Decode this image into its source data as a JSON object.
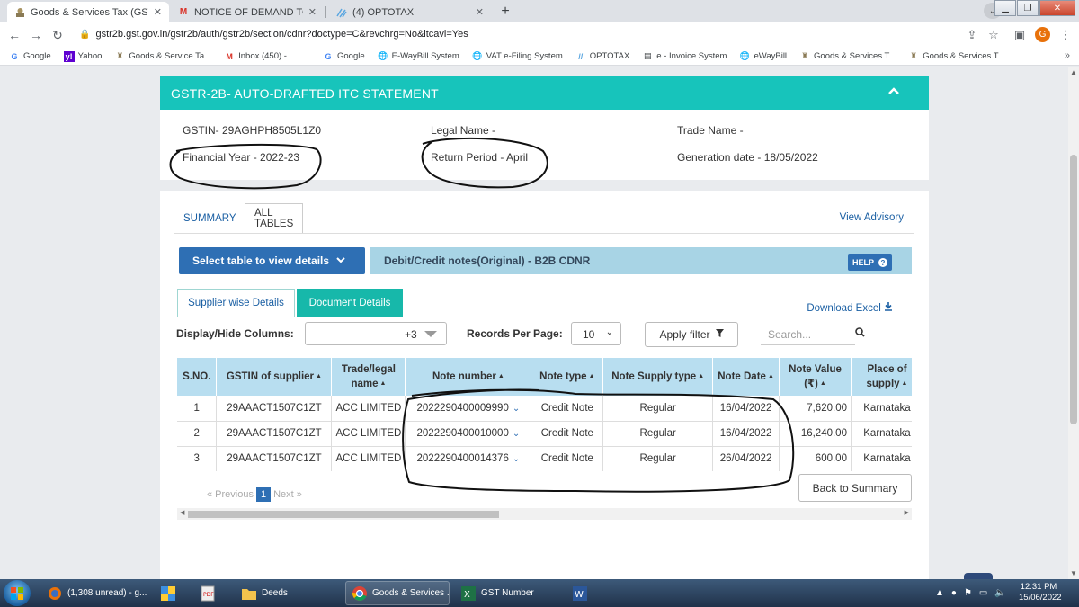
{
  "browser": {
    "tabs": [
      {
        "title": "Goods & Services Tax (GST) | GST",
        "active": true
      },
      {
        "title": "NOTICE OF DEMAND TO ENROLL",
        "active": false
      },
      {
        "title": "(4) OPTOTAX",
        "active": false
      }
    ],
    "url": "gstr2b.gst.gov.in/gstr2b/auth/gstr2b/section/cdnr?doctype=C&revchrg=No&itcavl=Yes",
    "profile_initial": "G",
    "bookmarks": [
      {
        "label": "Google",
        "icon": "google-g-icon"
      },
      {
        "label": "Yahoo",
        "icon": "yahoo-icon"
      },
      {
        "label": "Goods & Service Ta...",
        "icon": "emblem-icon"
      },
      {
        "label": "Inbox (450) -",
        "icon": "gmail-icon"
      },
      {
        "label": "Google",
        "icon": "google-g-icon"
      },
      {
        "label": "E-WayBill System",
        "icon": "globe-icon"
      },
      {
        "label": "VAT e-Filing System",
        "icon": "globe-icon"
      },
      {
        "label": "OPTOTAX",
        "icon": "optotax-icon"
      },
      {
        "label": "e - Invoice System",
        "icon": "document-icon"
      },
      {
        "label": "eWayBill",
        "icon": "globe-icon"
      },
      {
        "label": "Goods & Services T...",
        "icon": "emblem-icon"
      },
      {
        "label": "Goods & Services T...",
        "icon": "emblem-icon"
      }
    ]
  },
  "header": {
    "title": "GSTR-2B- AUTO-DRAFTED ITC STATEMENT"
  },
  "info": {
    "gstin": "GSTIN- 29AGHPH8505L1Z0",
    "legal_name": "Legal Name -",
    "trade_name": "Trade Name -",
    "financial_year": "Financial Year - 2022-23",
    "return_period": "Return Period - April",
    "generation_date": "Generation date - 18/05/2022"
  },
  "tabs": {
    "summary": "SUMMARY",
    "all_tables": "ALL TABLES",
    "view_advisory": "View Advisory"
  },
  "controls": {
    "select_table": "Select table to view details",
    "table_title": "Debit/Credit notes(Original) - B2B CDNR",
    "help": "HELP",
    "supplier_wise": "Supplier wise Details",
    "document_details": "Document Details",
    "download_excel": "Download Excel",
    "display_hide_label": "Display/Hide Columns:",
    "display_hide_value": "+3",
    "records_label": "Records Per Page:",
    "records_value": "10",
    "apply_filter": "Apply filter",
    "search_placeholder": "Search..."
  },
  "table": {
    "headers": [
      "S.NO.",
      "GSTIN of supplier",
      "Trade/legal name",
      "Note number",
      "Note type",
      "Note Supply type",
      "Note Date",
      "Note Value (₹)",
      "Place of supply"
    ],
    "rows": [
      [
        "1",
        "29AAACT1507C1ZT",
        "ACC LIMITED",
        "2022290400009990",
        "Credit Note",
        "Regular",
        "16/04/2022",
        "7,620.00",
        "Karnataka"
      ],
      [
        "2",
        "29AAACT1507C1ZT",
        "ACC LIMITED",
        "2022290400010000",
        "Credit Note",
        "Regular",
        "16/04/2022",
        "16,240.00",
        "Karnataka"
      ],
      [
        "3",
        "29AAACT1507C1ZT",
        "ACC LIMITED",
        "2022290400014376",
        "Credit Note",
        "Regular",
        "26/04/2022",
        "600.00",
        "Karnataka"
      ]
    ]
  },
  "pagination": {
    "previous": "« Previous",
    "current": "1",
    "next": "Next »"
  },
  "footer": {
    "back_to_summary": "Back to Summary"
  },
  "taskbar": {
    "items": [
      {
        "label": "(1,308 unread) - g...",
        "icon": "thunderbird-icon"
      },
      {
        "label": "",
        "icon": "windows-explorer-icon"
      },
      {
        "label": "",
        "icon": "pdf-icon"
      },
      {
        "label": "Deeds",
        "icon": "folder-icon"
      },
      {
        "label": "Goods & Services ...",
        "icon": "chrome-icon"
      },
      {
        "label": "GST Number",
        "icon": "excel-icon"
      },
      {
        "label": "",
        "icon": "word-icon"
      }
    ],
    "time": "12:31 PM",
    "date": "15/06/2022"
  },
  "colors": {
    "header_teal": "#17c4bb",
    "primary_blue": "#2e6fb4",
    "table_header": "#b8def0",
    "title_bar": "#a8d4e5"
  }
}
